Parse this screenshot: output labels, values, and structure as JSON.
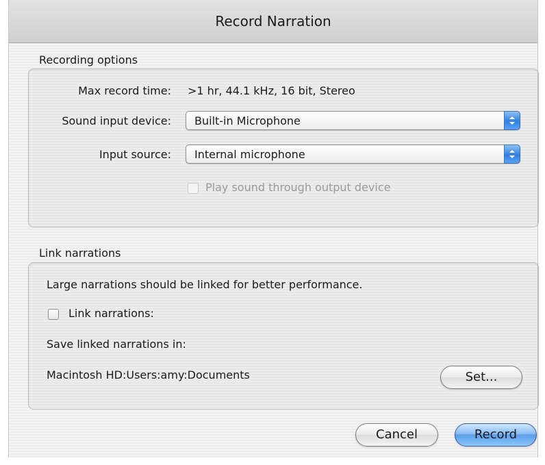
{
  "window": {
    "title": "Record Narration"
  },
  "recording_options": {
    "group_title": "Recording options",
    "max_record_time_label": "Max record time:",
    "max_record_time_value": ">1 hr, 44.1 kHz, 16 bit, Stereo",
    "sound_input_device_label": "Sound input device:",
    "sound_input_device_value": "Built-in Microphone",
    "input_source_label": "Input source:",
    "input_source_value": "Internal microphone",
    "play_through_label": "Play sound through output device",
    "play_through_checked": false,
    "play_through_enabled": false
  },
  "link_narrations": {
    "group_title": "Link narrations",
    "info_text": "Large narrations should be linked for better performance.",
    "checkbox_label": "Link narrations:",
    "checkbox_checked": false,
    "save_in_label": "Save linked narrations in:",
    "save_path": "Macintosh HD:Users:amy:Documents",
    "set_button_label": "Set..."
  },
  "footer": {
    "cancel_label": "Cancel",
    "record_label": "Record"
  },
  "colors": {
    "default_button": "#6aa8ee",
    "popup_arrow": "#2f7fe0"
  }
}
